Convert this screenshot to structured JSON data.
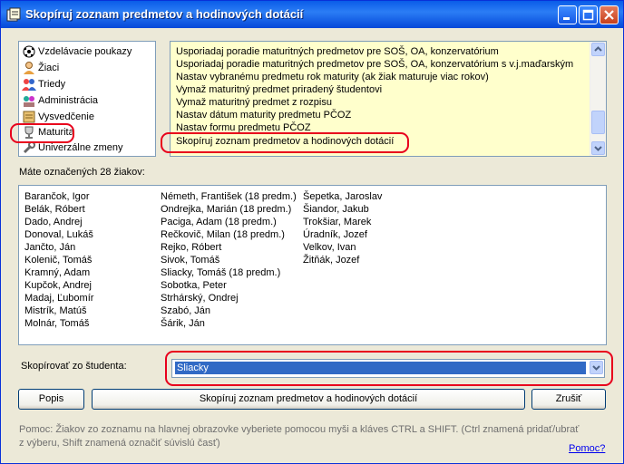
{
  "window": {
    "title": "Skopíruj zoznam predmetov a hodinových dotácií"
  },
  "modules": [
    {
      "label": "Vzdelávacie poukazy",
      "icon": "ball-icon"
    },
    {
      "label": "Žiaci",
      "icon": "student-icon"
    },
    {
      "label": "Triedy",
      "icon": "group-icon"
    },
    {
      "label": "Administrácia",
      "icon": "admin-icon"
    },
    {
      "label": "Vysvedčenie",
      "icon": "certificate-icon"
    },
    {
      "label": "Maturita",
      "icon": "trophy-icon"
    },
    {
      "label": "Univerzálne zmeny",
      "icon": "wrench-icon"
    }
  ],
  "actions": [
    "Usporiadaj poradie maturitných predmetov pre SOŠ, OA, konzervatórium",
    "Usporiadaj poradie maturitných predmetov pre SOŠ, OA, konzervatórium s v.j.maďarským",
    "Nastav vybranému predmetu rok maturity (ak žiak maturuje viac rokov)",
    "Vymaž maturitný predmet priradený študentovi",
    "Vymaž maturitný predmet z rozpisu",
    "Nastav dátum maturity predmetu PČOZ",
    "Nastav formu predmetu PČOZ",
    "Skopíruj zoznam predmetov a hodinových dotácií"
  ],
  "selected_count_label": "Máte označených 28 žiakov:",
  "students": {
    "col1": [
      "Barančok, Igor",
      "Belák, Róbert",
      "Dado, Andrej",
      "Donoval, Lukáš",
      "Jančto, Ján",
      "Kolenič, Tomáš",
      "Kramný, Adam",
      "Kupčok, Andrej",
      "Madaj, Ľubomír",
      "Mistrík, Matúš",
      "Molnár, Tomáš"
    ],
    "col2": [
      "Németh, František (18 predm.)",
      "Ondrejka, Marián (18 predm.)",
      "Paciga, Adam (18 predm.)",
      "Rečkovič, Milan (18 predm.)",
      "Rejko, Róbert",
      "Sivok, Tomáš",
      "Sliacky, Tomáš (18 predm.)",
      "Sobotka, Peter",
      "Strhárský, Ondrej",
      "Szabó, Ján",
      "Šárik, Ján"
    ],
    "col3": [
      "Šepetka, Jaroslav",
      "Šiandor, Jakub",
      "Trokšiar, Marek",
      "Úradník, Jozef",
      "Velkov, Ivan",
      "Žitňák, Jozef"
    ]
  },
  "copy_from": {
    "label": "Skopírovať zo študenta:",
    "value": "Sliacky"
  },
  "buttons": {
    "describe": "Popis",
    "execute": "Skopíruj zoznam predmetov a hodinových dotácií",
    "cancel": "Zrušiť"
  },
  "help": {
    "line1": "Pomoc: Žiakov zo zoznamu na hlavnej obrazovke vyberiete pomocou myši a kláves CTRL a SHIFT. (Ctrl znamená pridať/ubrať",
    "line2": "z výberu, Shift znamená označiť súvislú časť)",
    "link": "Pomoc?"
  }
}
